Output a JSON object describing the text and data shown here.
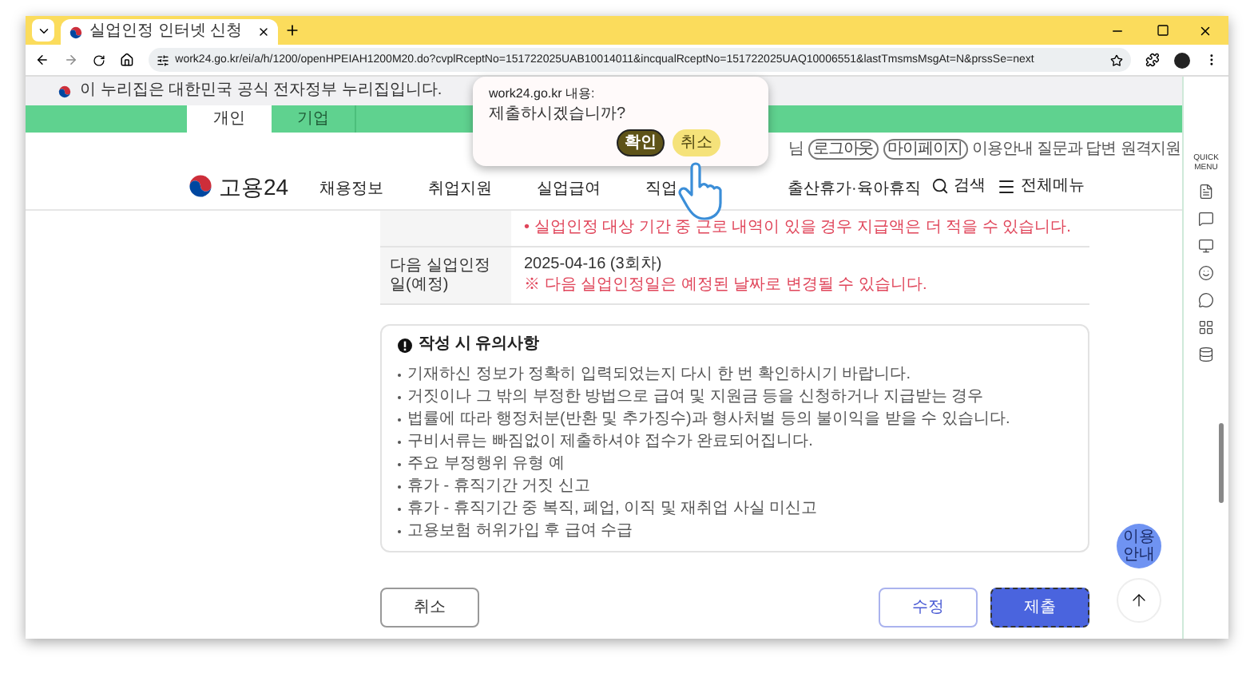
{
  "browser": {
    "tab_title": "실업인정 인터넷 신청",
    "url": "work24.go.kr/ei/a/h/1200/openHPEIAH1200M20.do?cvplRceptNo=151722025UAB10014011&incqualRceptNo=151722025UAQ10006551&lastTmsmsMsgAt=N&prssSe=next"
  },
  "gov_banner": "이 누리집은 대한민국 공식 전자정부 누리집입니다.",
  "user_tabs": [
    {
      "label": "개인",
      "selected": true
    },
    {
      "label": "기업",
      "selected": false
    }
  ],
  "utility_links": [
    {
      "label": "님",
      "kind": "text"
    },
    {
      "label": "로그아웃",
      "kind": "pill"
    },
    {
      "label": "마이페이지",
      "kind": "pill"
    },
    {
      "label": "이용안내",
      "kind": "link"
    },
    {
      "label": "질문과 답변",
      "kind": "link"
    },
    {
      "label": "원격지원",
      "kind": "link"
    }
  ],
  "site": {
    "logo": "고용24",
    "nav": [
      "채용정보",
      "취업지원",
      "실업급여",
      "직업",
      "출산휴가·육아휴직"
    ],
    "search": "검색",
    "all_menu": "전체메뉴"
  },
  "details": [
    {
      "notes": [
        "• 실업인정 대상 기간 중 근로 내역이 있을 경우 지급액은 더 적을 수 있습니다."
      ]
    },
    {
      "label": "다음 실업인정일(예정)",
      "value": "2025-04-16 (3회차)",
      "notes": [
        "※ 다음 실업인정일은 예정된 날짜로 변경될 수 있습니다."
      ]
    }
  ],
  "notice": {
    "title": "작성 시 유의사항",
    "items": [
      "기재하신 정보가 정확히 입력되었는지 다시 한 번 확인하시기 바랍니다.",
      "거짓이나 그 밖의 부정한 방법으로 급여 및 지원금 등을 신청하거나 지급받는 경우",
      "법률에 따라 행정처분(반환 및 추가징수)과 형사처벌 등의 불이익을 받을 수 있습니다.",
      "구비서류는 빠짐없이 제출하셔야 접수가 완료되어집니다.",
      "주요 부정행위 유형 예",
      "휴가 - 휴직기간 거짓 신고",
      "휴가 - 휴직기간 중 복직, 폐업, 이직 및 재취업 사실 미신고",
      "고용보험 허위가입 후 급여 수급"
    ]
  },
  "actions": [
    {
      "label": "취소",
      "kind": "cancel"
    },
    {
      "label": "수정",
      "kind": "edit"
    },
    {
      "label": "제출",
      "kind": "submit"
    }
  ],
  "guide_button": "이용 안내",
  "quick_menu": {
    "title": "QUICK MENU"
  },
  "dialog": {
    "origin": "work24.go.kr 내용:",
    "message": "제출하시겠습니까?",
    "buttons": [
      {
        "label": "확인",
        "selected": true
      },
      {
        "label": "취소",
        "selected": false
      }
    ]
  }
}
